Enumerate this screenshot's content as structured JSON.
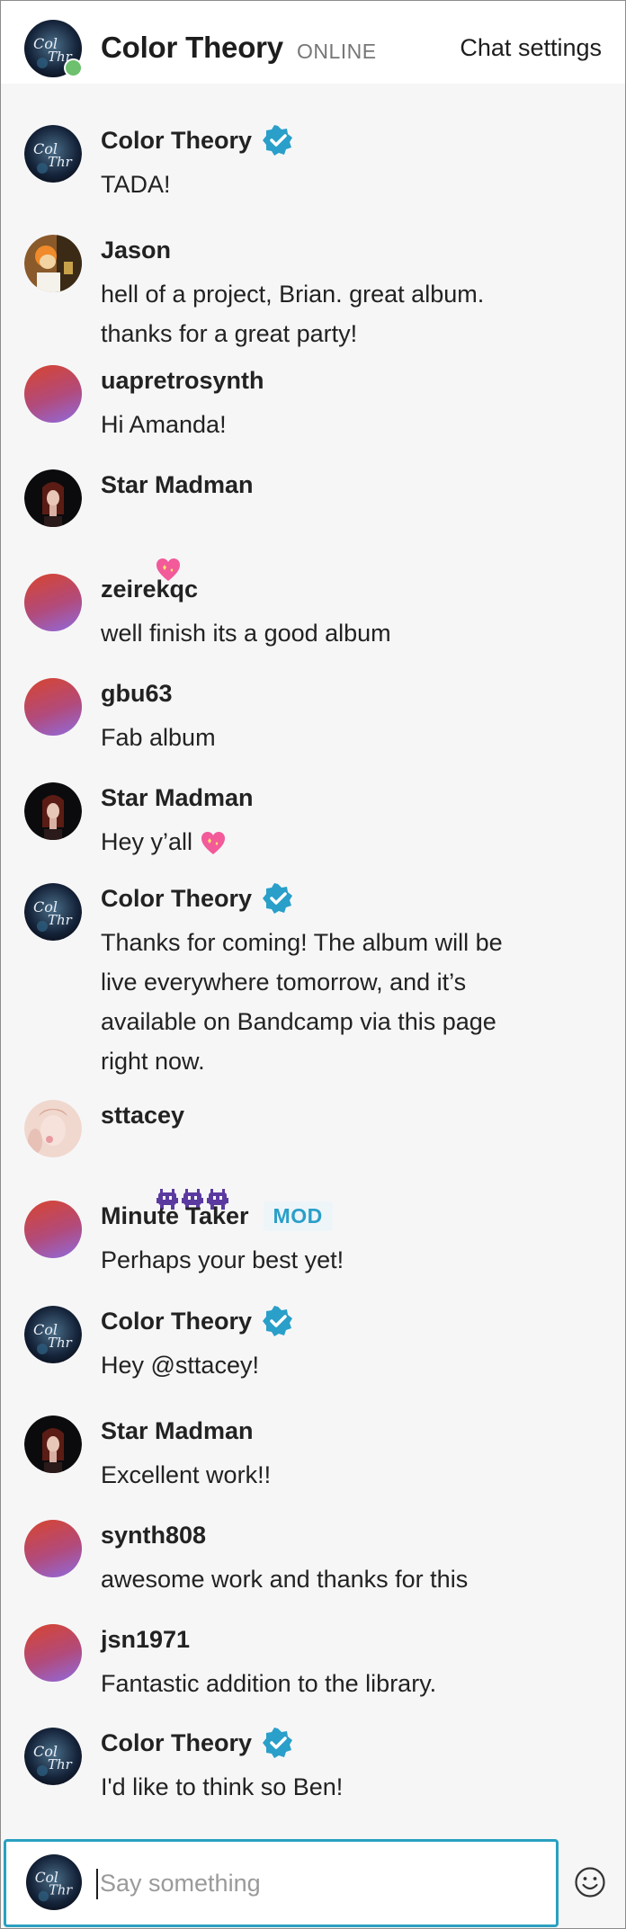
{
  "header": {
    "title": "Color Theory",
    "status": "ONLINE",
    "settings_label": "Chat settings"
  },
  "input": {
    "placeholder": "Say something"
  },
  "colors": {
    "accent": "#2aa0c0",
    "verified": "#2a9fc9",
    "online": "#6cc06e",
    "mod_badge_bg": "#eef5f9"
  },
  "icons": {
    "verified": "verified-badge-icon",
    "emoji": "smiley-icon",
    "heart": "sparkling-heart-emoji",
    "invader": "alien-monster-emoji"
  },
  "messages": [
    {
      "author": "Color Theory",
      "text": "TADA!",
      "verified": true,
      "avatar": "band"
    },
    {
      "author": "Jason",
      "text": "hell of a project, Brian. great album.\nthanks for a great party!",
      "avatar": "jason"
    },
    {
      "author": "uapretrosynth",
      "text": "Hi Amanda!",
      "avatar": "gradient"
    },
    {
      "author": "Star Madman",
      "text": "",
      "emoji": "heart",
      "avatar": "star"
    },
    {
      "author": "zeirekqc",
      "text": "well finish its a good album",
      "avatar": "gradient"
    },
    {
      "author": "gbu63",
      "text": "Fab album",
      "avatar": "gradient"
    },
    {
      "author": "Star Madman",
      "text": "Hey y’all",
      "emoji": "heart",
      "avatar": "star"
    },
    {
      "author": "Color Theory",
      "text": "Thanks for coming! The album will be\nlive everywhere tomorrow, and it’s\navailable on Bandcamp via this page\nright now.",
      "verified": true,
      "avatar": "band"
    },
    {
      "author": "sttacey",
      "text": "",
      "emoji": "invaders",
      "avatar": "sttacey"
    },
    {
      "author": "Minute Taker",
      "text": "Perhaps your best yet!",
      "badge": "MOD",
      "avatar": "gradient"
    },
    {
      "author": "Color Theory",
      "text": "Hey @sttacey!",
      "verified": true,
      "avatar": "band"
    },
    {
      "author": "Star Madman",
      "text": "Excellent work!!",
      "avatar": "star"
    },
    {
      "author": "synth808",
      "text": "awesome work and thanks for this",
      "avatar": "gradient"
    },
    {
      "author": "jsn1971",
      "text": "Fantastic addition to the library.",
      "avatar": "gradient"
    },
    {
      "author": "Color Theory",
      "text": "I'd like to think so Ben!",
      "verified": true,
      "avatar": "band"
    }
  ]
}
